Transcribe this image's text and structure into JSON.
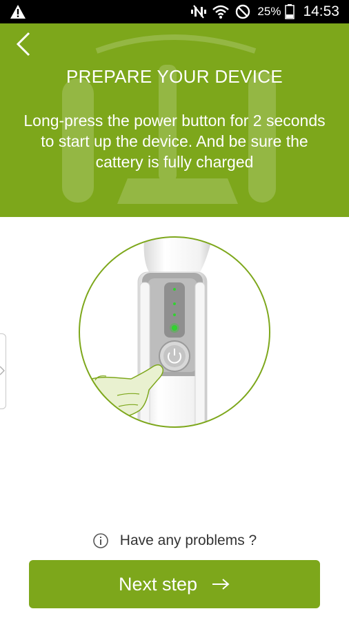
{
  "status_bar": {
    "battery_percent": "25%",
    "time": "14:53",
    "icons": [
      "warning-icon",
      "mute-icon",
      "wifi-icon",
      "do-not-disturb-icon",
      "battery-icon"
    ]
  },
  "header": {
    "title": "PREPARE YOUR DEVICE",
    "description": "Long-press the power button for 2 seconds to start up the device. And be sure the cattery is fully charged",
    "background_color": "#7da71b",
    "icons": [
      "back-chevron-icon"
    ]
  },
  "illustration": {
    "name": "device-power-button-illustration",
    "icons": [
      "power-icon",
      "pointing-hand-icon"
    ],
    "accent_color": "#7da71b",
    "led_color": "#31d22f"
  },
  "help": {
    "label": "Have any problems ?",
    "icon": "info-icon"
  },
  "next_button": {
    "label": "Next step",
    "icon": "arrow-right-icon",
    "color": "#7da71b"
  }
}
